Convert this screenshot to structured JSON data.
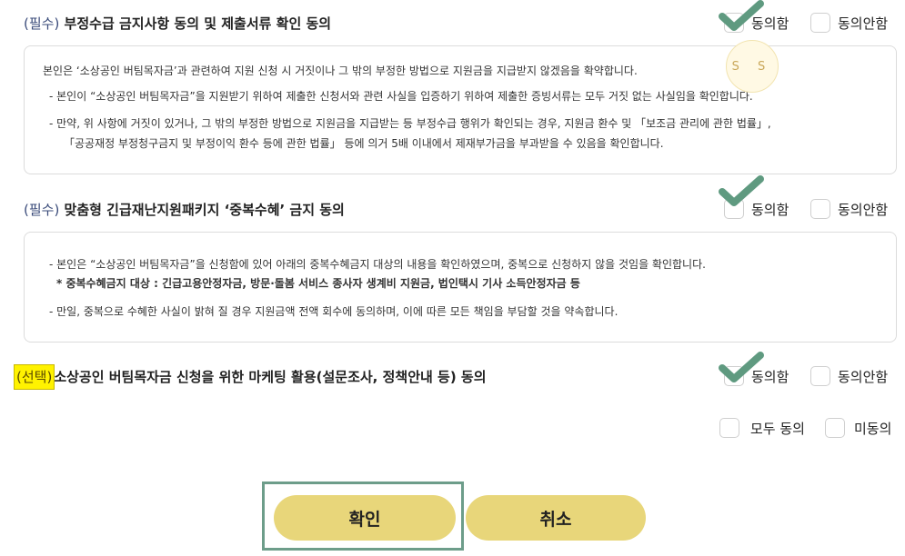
{
  "sections": [
    {
      "prefix": "(필수)",
      "title": "부정수급 금지사항 동의 및 제출서류 확인 동의",
      "agree_label": "동의함",
      "disagree_label": "동의안함",
      "agree_checked": true,
      "lines": [
        "본인은 ‘소상공인 버팀목자금’과 관련하여 지원 신청 시 거짓이나 그 밖의 부정한 방법으로 지원금을 지급받지 않겠음을 확약합니다.",
        "- 본인이 “소상공인 버팀목자금”을 지원받기 위하여 제출한 신청서와 관련 사실을 입증하기 위하여 제출한 증빙서류는 모두 거짓 없는 사실임을 확인합니다.",
        "- 만약, 위 사항에 거짓이 있거나, 그 밖의 부정한 방법으로 지원금을 지급받는 등 부정수급 행위가 확인되는 경우, 지원금 환수 및 「보조금 관리에 관한 법률」,",
        "「공공재정 부정청구금지 및 부정이익 환수 등에 관한 법률」 등에 의거 5배 이내에서 제재부가금을 부과받을 수 있음을 확인합니다."
      ]
    },
    {
      "prefix": "(필수)",
      "title": "맞춤형 긴급재난지원패키지 ‘중복수혜’ 금지 동의",
      "agree_label": "동의함",
      "disagree_label": "동의안함",
      "agree_checked": true,
      "lines": [
        "- 본인은 “소상공인 버팀목자금”을 신청함에 있어 아래의 중복수혜금지 대상의 내용을 확인하였으며, 중복으로 신청하지 않을 것임을 확인합니다.",
        "* 중복수혜금지 대상 : 긴급고용안정자금, 방문·돌봄 서비스 종사자 생계비 지원금, 법인택시 기사 소득안정자금 등",
        "- 만일, 중복으로 수혜한 사실이 밝혀 질 경우 지원금액 전액 회수에 동의하며, 이에 따른 모든 책임을 부담할 것을 약속합니다."
      ]
    },
    {
      "prefix": "(선택)",
      "title": "소상공인 버팀목자금 신청을 위한 마케팅 활용(설문조사, 정책안내 등) 동의",
      "agree_label": "동의함",
      "disagree_label": "동의안함",
      "agree_checked": true
    }
  ],
  "all_agree_label": "모두 동의",
  "all_disagree_label": "미동의",
  "stamp_text": "S S",
  "confirm_label": "확인",
  "cancel_label": "취소",
  "colors": {
    "button": "#e8d67a",
    "check": "#5f9a80",
    "highlight": "#fff200",
    "focus": "#6d9d8a"
  }
}
